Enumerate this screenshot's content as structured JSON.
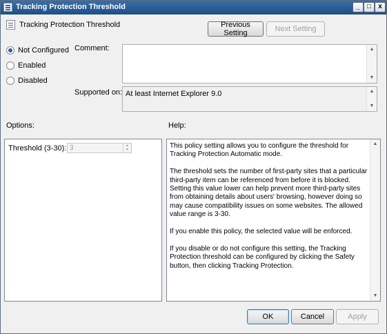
{
  "window": {
    "title": "Tracking Protection Threshold",
    "controls": {
      "minimize": "_",
      "maximize": "□",
      "close": "x"
    }
  },
  "header": {
    "setting_name": "Tracking Protection Threshold",
    "previous_label": "Previous Setting",
    "next_label": "Next Setting"
  },
  "state": {
    "options": [
      {
        "label": "Not Configured",
        "checked": true
      },
      {
        "label": "Enabled",
        "checked": false
      },
      {
        "label": "Disabled",
        "checked": false
      }
    ]
  },
  "comment": {
    "label": "Comment:",
    "value": ""
  },
  "supported": {
    "label": "Supported on:",
    "value": "At least Internet Explorer 9.0"
  },
  "options_pane": {
    "heading": "Options:",
    "threshold_label": "Threshold (3-30):",
    "threshold_value": "3"
  },
  "help_pane": {
    "heading": "Help:",
    "paragraphs": [
      "This policy setting allows you to configure the threshold for Tracking Protection Automatic mode.",
      "The threshold sets the number of first-party sites that a particular third-party item can be referenced from before it is blocked. Setting this value lower can help prevent more third-party sites from obtaining details about users' browsing, however doing so may cause compatibility issues on some websites. The allowed value range is 3-30.",
      "If you enable this policy, the selected value will be enforced.",
      "If you disable or do not configure this setting, the Tracking Protection threshold can be configured by clicking the Safety button, then clicking Tracking Protection."
    ]
  },
  "footer": {
    "ok_label": "OK",
    "cancel_label": "Cancel",
    "apply_label": "Apply"
  },
  "scroll_arrows": {
    "up": "▲",
    "down": "▼"
  },
  "colors": {
    "title_bar": "#1d4f86",
    "dialog_bg": "#f0f0f0",
    "radio_dot": "#2a5fa0"
  }
}
